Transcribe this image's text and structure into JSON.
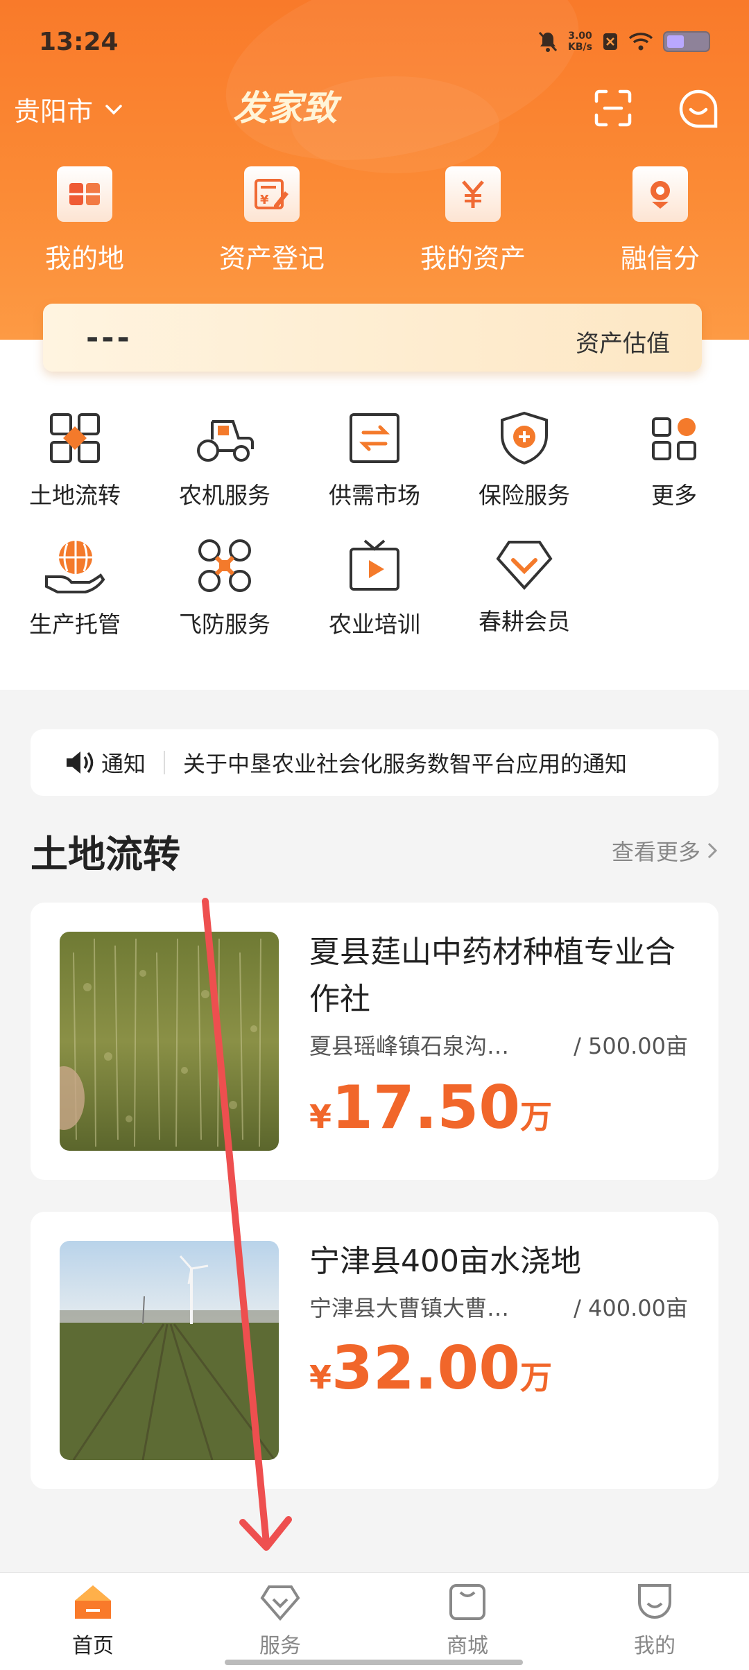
{
  "status_bar": {
    "time": "13:24",
    "speed_value": "3.00",
    "speed_unit": "KB/s"
  },
  "header": {
    "city": "贵阳市",
    "brand": "发家致"
  },
  "quick_actions": [
    {
      "label": "我的地",
      "icon": "land-book-icon"
    },
    {
      "label": "资产登记",
      "icon": "asset-register-icon"
    },
    {
      "label": "我的资产",
      "icon": "yen-asset-icon"
    },
    {
      "label": "融信分",
      "icon": "credit-score-icon"
    }
  ],
  "valuation": {
    "value": "---",
    "label": "资产估值"
  },
  "services": [
    {
      "label": "土地流转",
      "icon": "land-transfer-icon"
    },
    {
      "label": "农机服务",
      "icon": "tractor-icon"
    },
    {
      "label": "供需市场",
      "icon": "exchange-icon"
    },
    {
      "label": "保险服务",
      "icon": "shield-plus-icon"
    },
    {
      "label": "更多",
      "icon": "more-grid-icon"
    },
    {
      "label": "生产托管",
      "icon": "globe-hand-icon"
    },
    {
      "label": "飞防服务",
      "icon": "drone-icon"
    },
    {
      "label": "农业培训",
      "icon": "tv-play-icon"
    },
    {
      "label": "春耕会员",
      "icon": "diamond-member-icon"
    }
  ],
  "notice": {
    "tag": "通知",
    "message": "关于中垦农业社会化服务数智平台应用的通知"
  },
  "land_section": {
    "title": "土地流转",
    "more": "查看更多"
  },
  "listings": [
    {
      "title": "夏县莛山中药材种植专业合作社",
      "location": "夏县瑶峰镇石泉沟…",
      "area": "/ 500.00亩",
      "currency": "¥",
      "price": "17.50",
      "unit": "万"
    },
    {
      "title": "宁津县400亩水浇地",
      "location": "宁津县大曹镇大曹…",
      "area": "/ 400.00亩",
      "currency": "¥",
      "price": "32.00",
      "unit": "万"
    }
  ],
  "tabs": [
    {
      "label": "首页",
      "icon": "home-icon",
      "active": true
    },
    {
      "label": "服务",
      "icon": "service-icon",
      "active": false
    },
    {
      "label": "商城",
      "icon": "mall-icon",
      "active": false
    },
    {
      "label": "我的",
      "icon": "profile-icon",
      "active": false
    }
  ],
  "colors": {
    "brand_orange": "#f97a2a",
    "price_orange": "#f1662a",
    "service_orange": "#f47a2b",
    "annotation_red": "#ee4f4f"
  }
}
